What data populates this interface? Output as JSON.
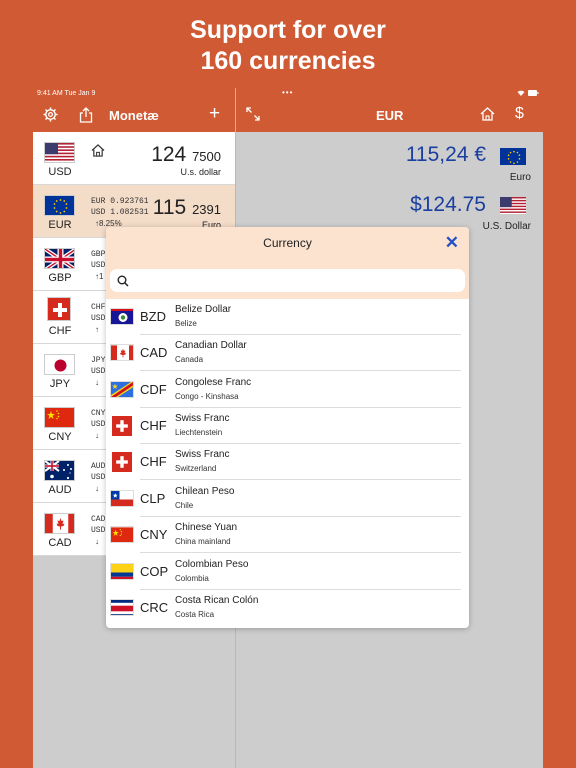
{
  "headline": {
    "line1": "Support for over",
    "line2": "160 currencies"
  },
  "statusbar": {
    "time": "9:41 AM   Tue Jan 9",
    "dots": "•••",
    "icons": "◆ ▮"
  },
  "nav": {
    "title": "Monetæ",
    "right_title": "EUR",
    "add": "+"
  },
  "rows": [
    {
      "code": "USD",
      "amount_int": "124",
      "amount_dec": "7500",
      "name": "U.s. dollar"
    },
    {
      "code": "EUR",
      "rate1": "EUR 0.923761",
      "rate2": "USD 1.082531",
      "change": "↑8.25%",
      "amount_int": "115",
      "amount_dec": "2391",
      "name": "Euro"
    },
    {
      "code": "GBP",
      "rate1": "GBP",
      "rate2": "USD",
      "change": "↑1"
    },
    {
      "code": "CHF",
      "rate1": "CHF",
      "rate2": "USD",
      "change": "↑"
    },
    {
      "code": "JPY",
      "rate1": "JPY",
      "rate2": "USD",
      "change": "↓"
    },
    {
      "code": "CNY",
      "rate1": "CNY",
      "rate2": "USD",
      "change": "↓"
    },
    {
      "code": "AUD",
      "rate1": "AUD",
      "rate2": "USD",
      "change": "↓"
    },
    {
      "code": "CAD",
      "rate1": "CAD",
      "rate2": "USD",
      "change": "↓"
    }
  ],
  "right": {
    "amount1": "115,24 €",
    "name1": "Euro",
    "amount2": "$124.75",
    "name2": "U.S. Dollar"
  },
  "modal": {
    "title": "Currency",
    "close": "✕",
    "search_placeholder": "",
    "items": [
      {
        "code": "BZD",
        "name": "Belize Dollar",
        "region": "Belize"
      },
      {
        "code": "CAD",
        "name": "Canadian Dollar",
        "region": "Canada"
      },
      {
        "code": "CDF",
        "name": "Congolese Franc",
        "region": "Congo - Kinshasa"
      },
      {
        "code": "CHF",
        "name": "Swiss Franc",
        "region": "Liechtenstein"
      },
      {
        "code": "CHF",
        "name": "Swiss Franc",
        "region": "Switzerland"
      },
      {
        "code": "CLP",
        "name": "Chilean Peso",
        "region": "Chile"
      },
      {
        "code": "CNY",
        "name": "Chinese Yuan",
        "region": "China mainland"
      },
      {
        "code": "COP",
        "name": "Colombian Peso",
        "region": "Colombia"
      },
      {
        "code": "CRC",
        "name": "Costa Rican Colón",
        "region": "Costa Rica"
      }
    ]
  },
  "colors": {
    "accent": "#cf5a33",
    "link": "#2451c6",
    "amount_blue": "#1a3fa0",
    "selected_row": "#f3dcc8",
    "modal_header": "#fbe3d0"
  }
}
